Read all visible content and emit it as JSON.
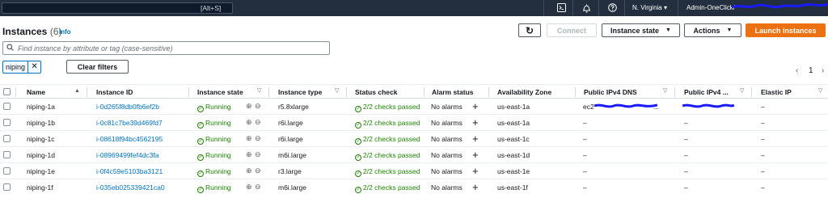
{
  "topbar": {
    "search_shortcut": "[Alt+S]",
    "icons": [
      "cloudshell-icon",
      "notifications-icon",
      "help-icon"
    ],
    "region": "N. Virginia ▾",
    "account": "Admin-OneClick/"
  },
  "header": {
    "title": "Instances",
    "count": "(6)",
    "info": "Info",
    "refresh": "↻",
    "connect": "Connect",
    "instance_state": "Instance state",
    "actions": "Actions",
    "launch": "Launch instances"
  },
  "filter": {
    "placeholder": "Find instance by attribute or tag (case-sensitive)",
    "token": "niping",
    "token_remove": "✕",
    "clear": "Clear filters"
  },
  "pagination": {
    "prev": "‹",
    "page": "1",
    "next": "›"
  },
  "columns": {
    "name": "Name",
    "instance_id": "Instance ID",
    "instance_state": "Instance state",
    "instance_type": "Instance type",
    "status_check": "Status check",
    "alarm_status": "Alarm status",
    "availability_zone": "Availability Zone",
    "public_dns": "Public IPv4 DNS",
    "public_ip": "Public IPv4 ...",
    "elastic_ip": "Elastic IP"
  },
  "rows": [
    {
      "name": "niping-1a",
      "id": "i-0d265f8db0fb6ef2b",
      "state": "Running",
      "type": "r5.8xlarge",
      "status": "2/2 checks passed",
      "alarm": "No alarms",
      "az": "us-east-1a",
      "dns": "ec2",
      "dns_suffix": "...",
      "ip": "",
      "eip": "–"
    },
    {
      "name": "niping-1b",
      "id": "i-0c81c7be39d469fd7",
      "state": "Running",
      "type": "r6i.large",
      "status": "2/2 checks passed",
      "alarm": "No alarms",
      "az": "us-east-1a",
      "dns": "–",
      "dns_suffix": "",
      "ip": "–",
      "eip": "–"
    },
    {
      "name": "niping-1c",
      "id": "i-08618f94bc4562195",
      "state": "Running",
      "type": "r6i.large",
      "status": "2/2 checks passed",
      "alarm": "No alarms",
      "az": "us-east-1c",
      "dns": "–",
      "dns_suffix": "",
      "ip": "–",
      "eip": "–"
    },
    {
      "name": "niping-1d",
      "id": "i-08969499fef4dc3fa",
      "state": "Running",
      "type": "m6i.large",
      "status": "2/2 checks passed",
      "alarm": "No alarms",
      "az": "us-east-1d",
      "dns": "–",
      "dns_suffix": "",
      "ip": "–",
      "eip": "–"
    },
    {
      "name": "niping-1e",
      "id": "i-0f4c59e5103ba3121",
      "state": "Running",
      "type": "r3.large",
      "status": "2/2 checks passed",
      "alarm": "No alarms",
      "az": "us-east-1e",
      "dns": "–",
      "dns_suffix": "",
      "ip": "–",
      "eip": "–"
    },
    {
      "name": "niping-1f",
      "id": "i-035eb025339421ca0",
      "state": "Running",
      "type": "m6i.large",
      "status": "2/2 checks passed",
      "alarm": "No alarms",
      "az": "us-east-1f",
      "dns": "–",
      "dns_suffix": "",
      "ip": "–",
      "eip": "–"
    }
  ],
  "colors": {
    "nav_bg": "#232f3e",
    "link": "#0073bb",
    "running": "#1d8102",
    "primary": "#ec7211",
    "redaction": "#1a1aff"
  }
}
